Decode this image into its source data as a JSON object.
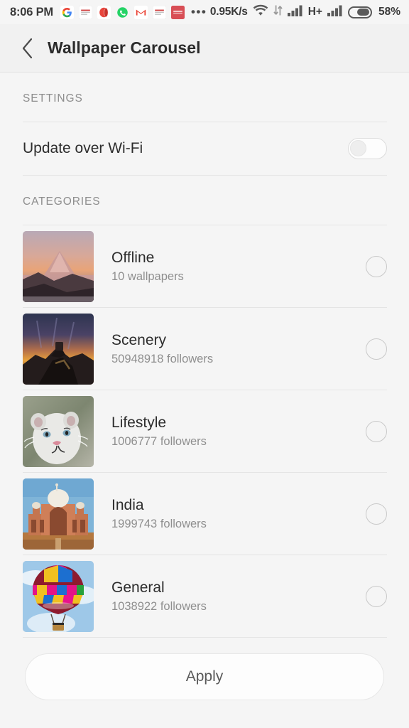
{
  "status_bar": {
    "time": "8:06 PM",
    "notification_icons": [
      "google-icon",
      "news-card-icon",
      "opera-icon",
      "whatsapp-icon",
      "gmail-icon",
      "news-card-icon-2",
      "redbus-icon"
    ],
    "overflow_dots": "•••",
    "network_speed": "0.95K/s",
    "wifi_icon": "wifi-icon",
    "data_transfer_icon": "data-arrows-icon",
    "signal_1_icon": "signal-bars-icon",
    "network_type": "H+",
    "signal_2_icon": "signal-bars-icon-2",
    "battery_icon": "battery-icon",
    "battery_percent": "58%",
    "battery_level": 58
  },
  "title_bar": {
    "back_icon": "back-chevron-icon",
    "title": "Wallpaper Carousel"
  },
  "settings": {
    "header": "SETTINGS",
    "rows": [
      {
        "label": "Update over Wi-Fi",
        "toggle_on": false
      }
    ]
  },
  "categories": {
    "header": "CATEGORIES",
    "items": [
      {
        "name": "Offline",
        "sub": "10 wallpapers",
        "thumb": "mountain-sunset-thumb",
        "selected": false
      },
      {
        "name": "Scenery",
        "sub": "50948918 followers",
        "thumb": "great-wall-dawn-thumb",
        "selected": false
      },
      {
        "name": "Lifestyle",
        "sub": "1006777 followers",
        "thumb": "white-tiger-cub-thumb",
        "selected": false
      },
      {
        "name": "India",
        "sub": "1999743 followers",
        "thumb": "humayuns-tomb-thumb",
        "selected": false
      },
      {
        "name": "General",
        "sub": "1038922 followers",
        "thumb": "hot-air-balloon-thumb",
        "selected": false
      }
    ]
  },
  "footer": {
    "apply_label": "Apply"
  },
  "colors": {
    "page_background": "#f5f5f5",
    "title_bar_background": "#f1f1f1",
    "divider": "#e4e4e4",
    "primary_text": "#2d2d2d",
    "secondary_text": "#8f8f8f",
    "section_label": "#8d8d8d"
  }
}
